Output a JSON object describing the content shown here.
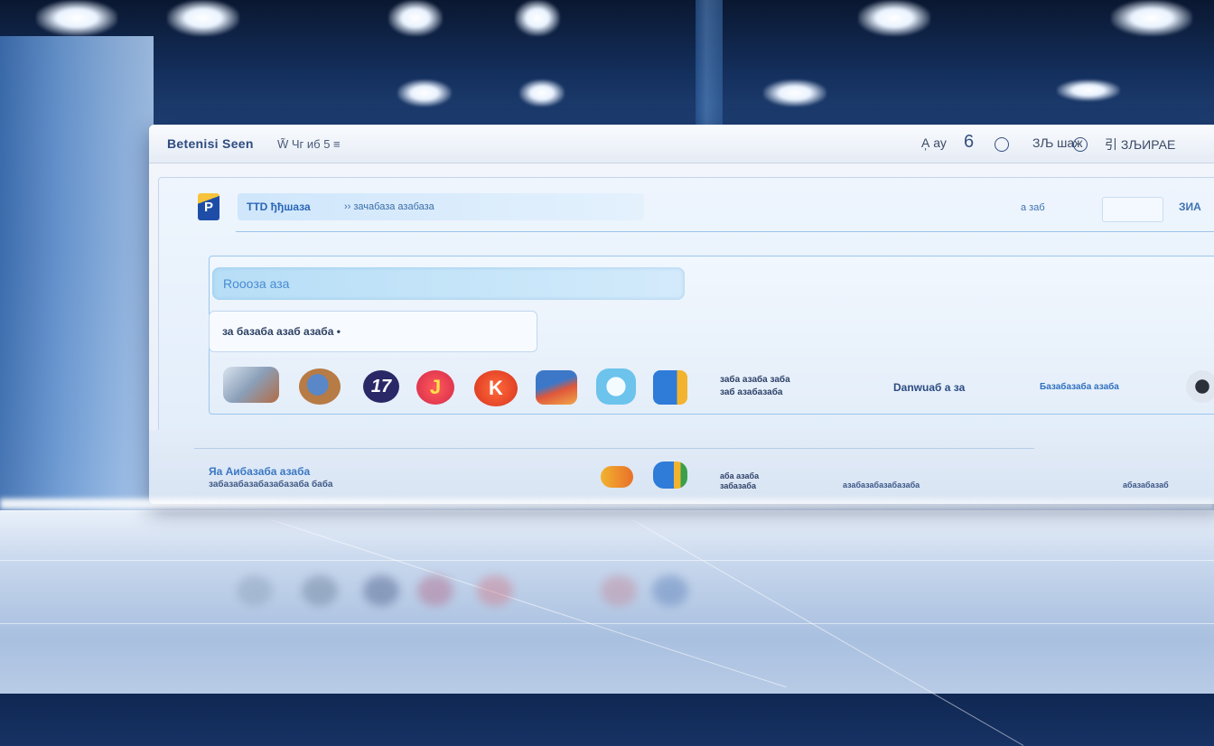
{
  "window": {
    "title": "Betenisi Seen",
    "subtitle": "W̃ Чг иб 5 ≡",
    "right_a": "A̩ ау",
    "right_num": "6",
    "right_b": "ЗЉ шаж",
    "right_c": "引 ЗЉИРАЕ"
  },
  "header": {
    "logo_text": "P",
    "bar_label": "TTD ђђшаза",
    "bar_text": "›› зачабаза азабаза",
    "right_text": "а заб",
    "right_tag": "ЗИА"
  },
  "panel": {
    "search_text": "Roooза    аза",
    "dropdown_text": "за базаба азаб азаба •",
    "icons": [
      {
        "name": "photo-collage-icon",
        "color": "#8a9fb8"
      },
      {
        "name": "globe-coin-icon",
        "color": "#b77b45"
      },
      {
        "name": "number-17-icon",
        "color": "#2a2866",
        "label": "17"
      },
      {
        "name": "letter-j-icon",
        "color": "#e23b3b",
        "label": "J"
      },
      {
        "name": "letter-k-icon",
        "color": "#e8442a",
        "label": "K"
      },
      {
        "name": "mountain-app-icon",
        "color": "#3d78c8"
      },
      {
        "name": "robot-app-icon",
        "color": "#6cc3ec"
      },
      {
        "name": "pen-app-icon",
        "color": "#2f7bd8"
      }
    ],
    "meta_line1": "заба азаба заба",
    "meta_line2": "заб азабазаба",
    "brand": "Danwuаб а за",
    "link_text": "Базабазаба азаба"
  },
  "bottom": {
    "title": "Яа Aибазаба азаба",
    "subtitle": "забазабазабазабазаба баба",
    "meta_line1": "аба азаба",
    "meta_line2": "забазаба",
    "link_text": "азабазабазабазаба",
    "tail_text": "абазабазаб"
  }
}
